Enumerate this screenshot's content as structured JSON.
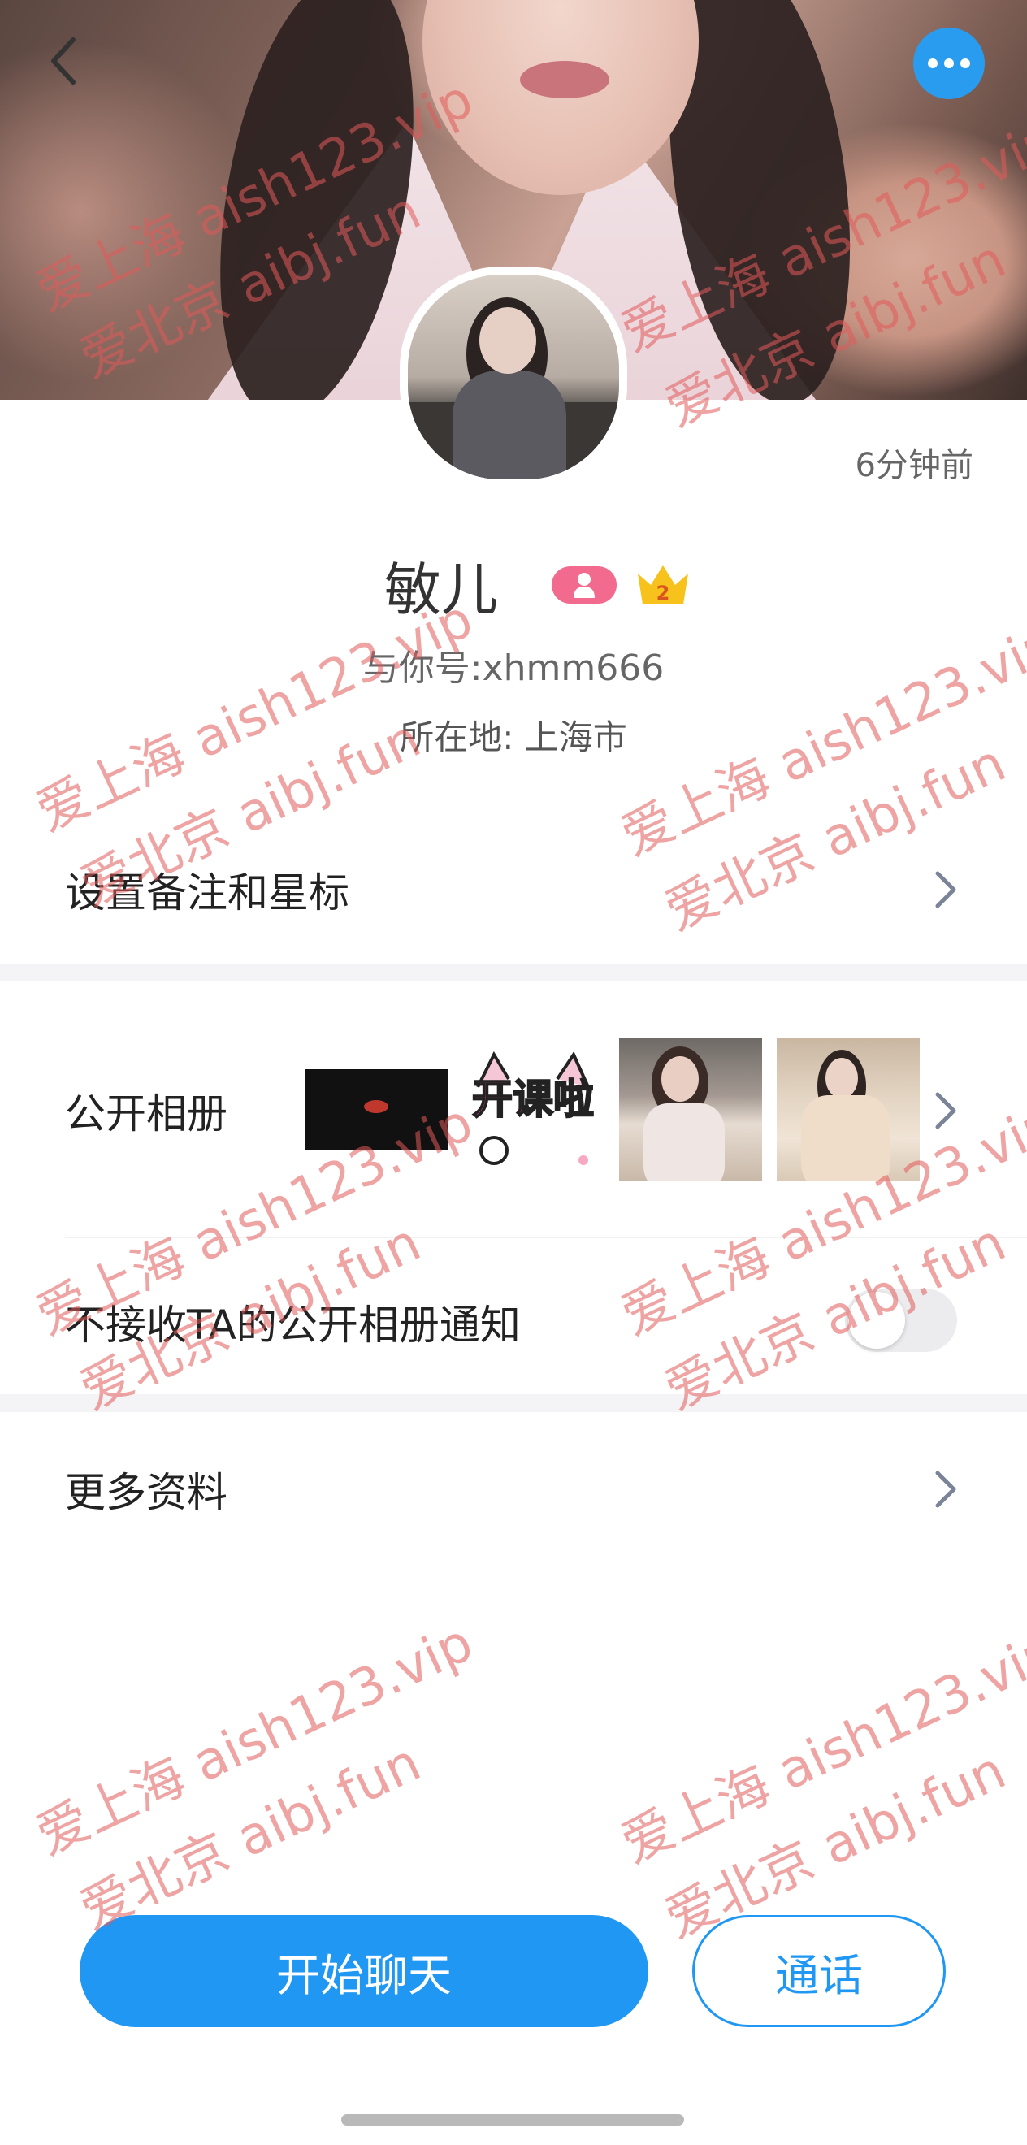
{
  "cover": {
    "icon": "cover-photo"
  },
  "nav": {
    "back_icon": "chevron-left-icon",
    "more_icon": "more-horizontal-icon"
  },
  "profile": {
    "last_active": "6分钟前",
    "name": "敏儿",
    "crown_level": "2",
    "uid": "与你号:xhmm666",
    "location": "所在地: 上海市"
  },
  "menu": {
    "remark": "设置备注和星标",
    "album": "公开相册",
    "album_thumb_text": "开课啦",
    "mute_album": "不接收TA的公开相册通知",
    "mute_album_on": false,
    "more_info": "更多资料"
  },
  "actions": {
    "chat": "开始聊天",
    "call": "通话"
  },
  "watermark": {
    "line1": "爱上海 aish123.vip",
    "line2": "爱北京 aibj.fun"
  },
  "colors": {
    "accent": "#1f97f3",
    "pink_badge": "#f26a8d",
    "crown": "#f7c21c",
    "watermark": "#e25a5a"
  }
}
